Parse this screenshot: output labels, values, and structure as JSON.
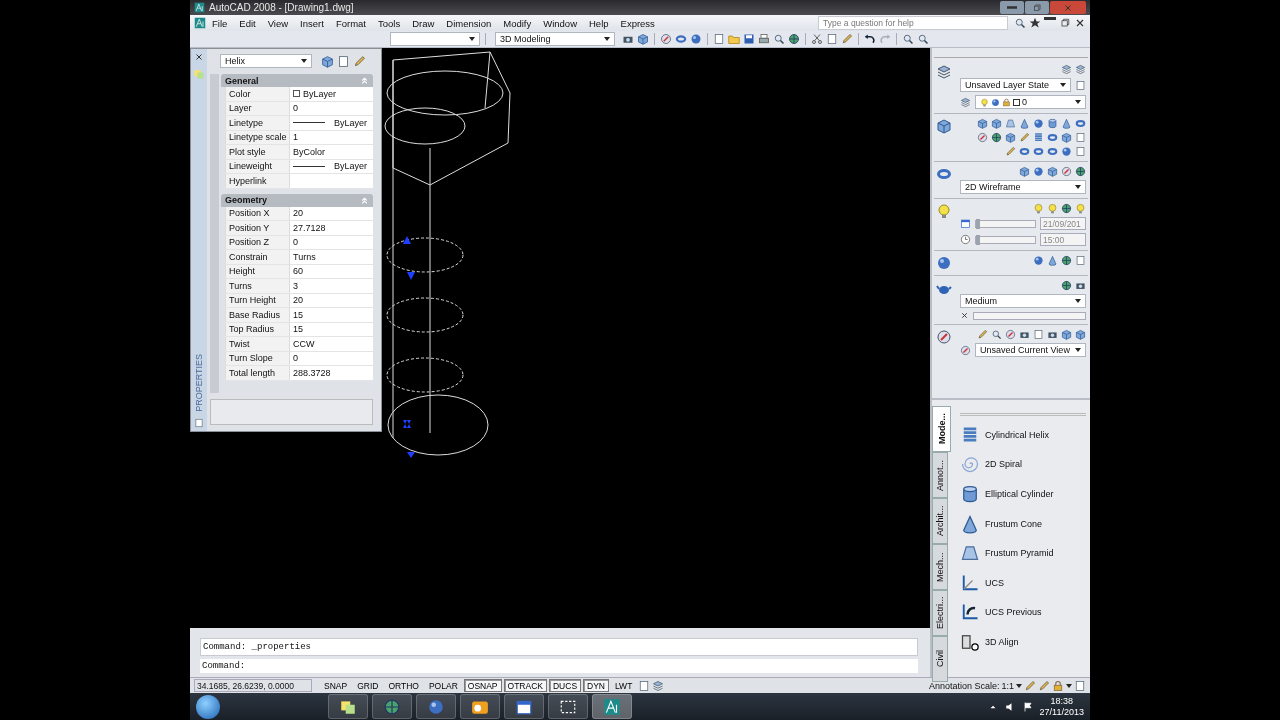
{
  "window": {
    "title": "AutoCAD 2008 - [Drawing1.dwg]"
  },
  "menu_bar": [
    "File",
    "Edit",
    "View",
    "Insert",
    "Format",
    "Tools",
    "Draw",
    "Dimension",
    "Modify",
    "Window",
    "Help",
    "Express"
  ],
  "help_search": {
    "placeholder": "Type a question for help"
  },
  "workspace_dropdown": {
    "value": "3D Modeling"
  },
  "properties_palette": {
    "title": "PROPERTIES",
    "object_type": "Helix",
    "sections": [
      {
        "title": "General",
        "expanded": true,
        "rows": [
          {
            "label": "Color",
            "value": "ByLayer",
            "kind": "color"
          },
          {
            "label": "Layer",
            "value": "0",
            "kind": "text"
          },
          {
            "label": "Linetype",
            "value": "ByLayer",
            "kind": "line"
          },
          {
            "label": "Linetype scale",
            "value": "1",
            "kind": "text"
          },
          {
            "label": "Plot style",
            "value": "ByColor",
            "kind": "text"
          },
          {
            "label": "Lineweight",
            "value": "ByLayer",
            "kind": "line"
          },
          {
            "label": "Hyperlink",
            "value": "",
            "kind": "text"
          }
        ]
      },
      {
        "title": "Geometry",
        "expanded": true,
        "rows": [
          {
            "label": "Position X",
            "value": "20",
            "kind": "text"
          },
          {
            "label": "Position Y",
            "value": "27.7128",
            "kind": "text"
          },
          {
            "label": "Position Z",
            "value": "0",
            "kind": "text"
          },
          {
            "label": "Constrain",
            "value": "Turns",
            "kind": "text"
          },
          {
            "label": "Height",
            "value": "60",
            "kind": "text"
          },
          {
            "label": "Turns",
            "value": "3",
            "kind": "text"
          },
          {
            "label": "Turn Height",
            "value": "20",
            "kind": "text"
          },
          {
            "label": "Base Radius",
            "value": "15",
            "kind": "text"
          },
          {
            "label": "Top Radius",
            "value": "15",
            "kind": "text"
          },
          {
            "label": "Twist",
            "value": "CCW",
            "kind": "text"
          },
          {
            "label": "Turn Slope",
            "value": "0",
            "kind": "text"
          },
          {
            "label": "Total length",
            "value": "288.3728",
            "kind": "text"
          }
        ]
      }
    ]
  },
  "dashboard": {
    "layer_state": "Unsaved Layer State",
    "layer": "0",
    "visual_style": "2D Wireframe",
    "date_slider": {
      "level": 0
    },
    "date": "21/09/201",
    "time_slider": {
      "level": 0
    },
    "time": "15:00",
    "render_preset": "Medium",
    "render_progress": {
      "level": 0
    },
    "view": "Unsaved Current View"
  },
  "tool_palette": {
    "tabs": [
      {
        "label": "Mode...",
        "selected": true
      },
      {
        "label": "Annot...",
        "selected": false
      },
      {
        "label": "Archit...",
        "selected": false
      },
      {
        "label": "Mech...",
        "selected": false
      },
      {
        "label": "Electri...",
        "selected": false
      },
      {
        "label": "Civil",
        "selected": false
      }
    ],
    "tools": [
      {
        "label": "Cylindrical Helix",
        "kind": "helix"
      },
      {
        "label": "2D Spiral",
        "kind": "spiral"
      },
      {
        "label": "Elliptical Cylinder",
        "kind": "cylinder"
      },
      {
        "label": "Frustum Cone",
        "kind": "cone"
      },
      {
        "label": "Frustum Pyramid",
        "kind": "pyramid"
      },
      {
        "label": "UCS",
        "kind": "ucs"
      },
      {
        "label": "UCS Previous",
        "kind": "ucs-previous"
      },
      {
        "label": "3D Align",
        "kind": "align"
      }
    ]
  },
  "command_line": {
    "history": "Command: _properties",
    "prompt": "Command:"
  },
  "status_bar": {
    "coordinates": "34.1685, 26.6239, 0.0000",
    "toggles": [
      {
        "label": "SNAP",
        "on": false
      },
      {
        "label": "GRID",
        "on": false
      },
      {
        "label": "ORTHO",
        "on": false
      },
      {
        "label": "POLAR",
        "on": false
      },
      {
        "label": "OSNAP",
        "on": true
      },
      {
        "label": "OTRACK",
        "on": true
      },
      {
        "label": "DUCS",
        "on": true
      },
      {
        "label": "DYN",
        "on": true
      },
      {
        "label": "LWT",
        "on": false
      }
    ],
    "annotation_scale_label": "Annotation Scale:",
    "annotation_scale": "1:1"
  },
  "taskbar": {
    "time": "18:38",
    "date": "27/11/2013"
  }
}
